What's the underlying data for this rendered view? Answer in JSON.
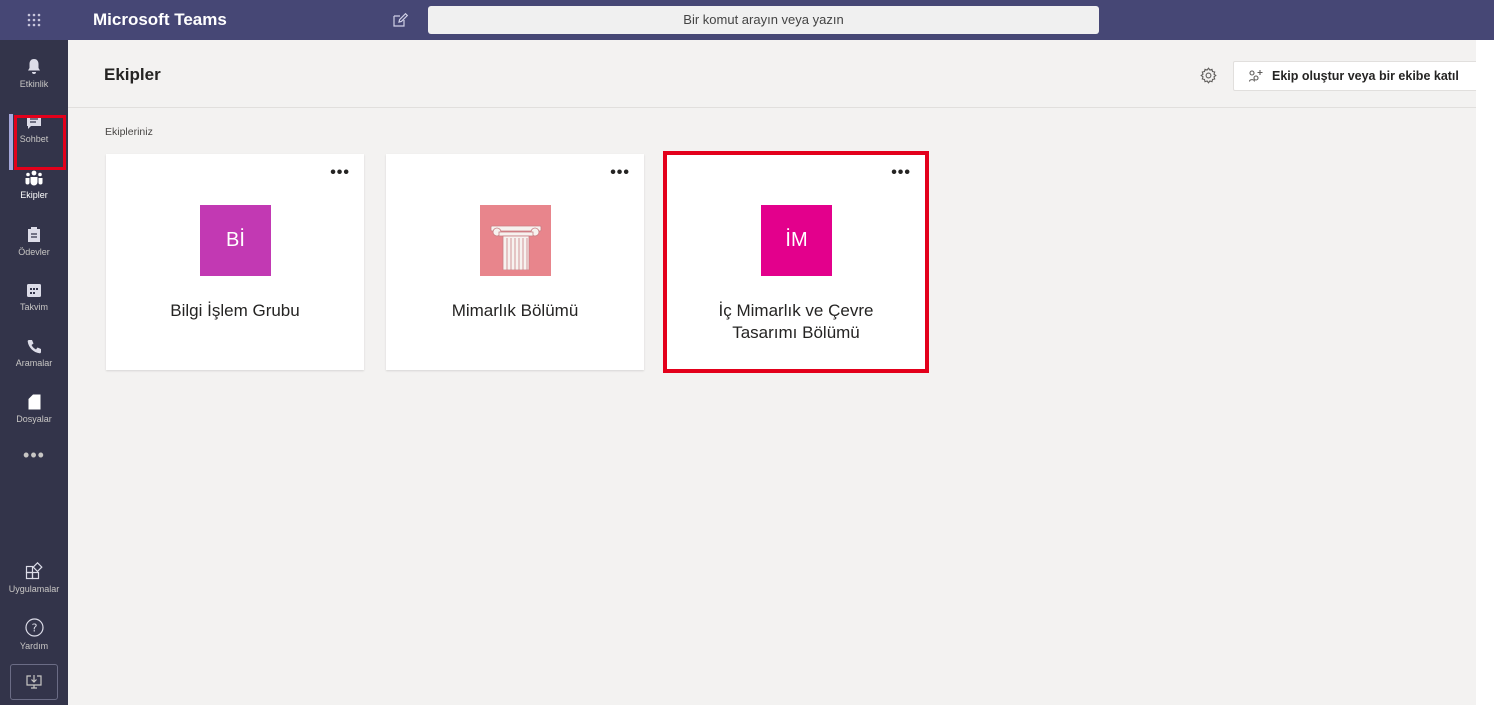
{
  "app": {
    "title": "Microsoft Teams",
    "search_placeholder": "Bir komut arayın veya yazın"
  },
  "rail": {
    "items": [
      {
        "label": "Etkinlik",
        "icon": "bell-icon"
      },
      {
        "label": "Sohbet",
        "icon": "chat-icon"
      },
      {
        "label": "Ekipler",
        "icon": "teams-icon",
        "active": true
      },
      {
        "label": "Ödevler",
        "icon": "assignments-icon"
      },
      {
        "label": "Takvim",
        "icon": "calendar-icon"
      },
      {
        "label": "Aramalar",
        "icon": "phone-icon"
      },
      {
        "label": "Dosyalar",
        "icon": "file-icon"
      }
    ],
    "more": "•••",
    "bottom": [
      {
        "label": "Uygulamalar",
        "icon": "apps-icon"
      },
      {
        "label": "Yardım",
        "icon": "help-icon"
      }
    ]
  },
  "header": {
    "title": "Ekipler",
    "create_button": "Ekip oluştur veya bir ekibe katıl"
  },
  "section_label": "Ekipleriniz",
  "teams": [
    {
      "name": "Bilgi İşlem Grubu",
      "initials": "Bİ",
      "color": "#c239b3"
    },
    {
      "name": "Mimarlık Bölümü",
      "initials": "",
      "color": "#e8858c",
      "image": "column-icon"
    },
    {
      "name": "İç Mimarlık ve Çevre Tasarımı Bölümü",
      "initials": "İM",
      "color": "#e3008c"
    }
  ],
  "colors": {
    "topbar": "#464775",
    "rail": "#33344a",
    "highlight": "#e3001b"
  }
}
